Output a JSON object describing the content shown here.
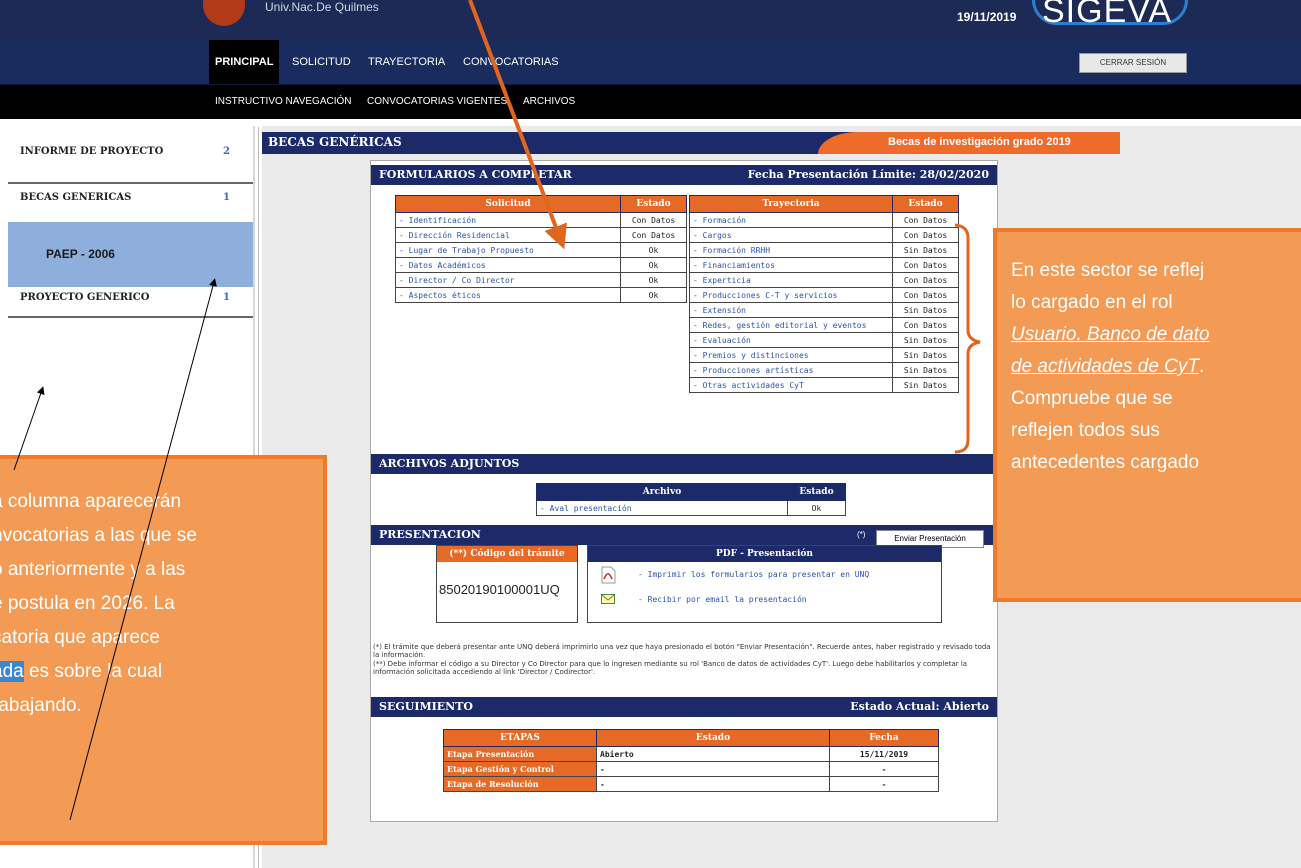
{
  "header": {
    "institution": "Univ.Nac.De Quilmes",
    "date": "19/11/2019",
    "brand": "SIGEVA",
    "logout_label": "CERRAR SESIÓN"
  },
  "nav_main": [
    "PRINCIPAL",
    "SOLICITUD",
    "TRAYECTORIA",
    "CONVOCATORIAS"
  ],
  "nav_sub": [
    "INSTRUCTIVO NAVEGACIÓN",
    "CONVOCATORIAS VIGENTES",
    "ARCHIVOS"
  ],
  "sidebar": {
    "items": [
      {
        "label": "INFORME DE PROYECTO",
        "count": "2"
      },
      {
        "label": "BECAS GENERICAS",
        "count": "1"
      },
      {
        "label": "PAEP - 2006",
        "count": ""
      },
      {
        "label": "PROYECTO GENERICO",
        "count": "1"
      }
    ]
  },
  "page": {
    "title": "BECAS GENÉRICAS",
    "subtitle": "Becas de investigación grado 2019"
  },
  "forms": {
    "title": "FORMULARIOS A COMPLETAR",
    "deadline": "Fecha Presentación Límite: 28/02/2020",
    "solicitud": {
      "headers": [
        "Solicitud",
        "Estado"
      ],
      "rows": [
        [
          "- Identificación",
          "Con Datos"
        ],
        [
          "- Dirección Residencial",
          "Con Datos"
        ],
        [
          "- Lugar de Trabajo Propuesto",
          "Ok"
        ],
        [
          "- Datos Académicos",
          "Ok"
        ],
        [
          "- Director / Co Director",
          "Ok"
        ],
        [
          "- Aspectos éticos",
          "Ok"
        ]
      ]
    },
    "trayectoria": {
      "headers": [
        "Trayectoria",
        "Estado"
      ],
      "rows": [
        [
          "- Formación",
          "Con Datos"
        ],
        [
          "- Cargos",
          "Con Datos"
        ],
        [
          "- Formación RRHH",
          "Sin Datos"
        ],
        [
          "- Financiamientos",
          "Con Datos"
        ],
        [
          "- Experticia",
          "Con Datos"
        ],
        [
          "- Producciones C-T y servicios",
          "Con Datos"
        ],
        [
          "- Extensión",
          "Sin Datos"
        ],
        [
          "- Redes, gestión editorial y eventos",
          "Con Datos"
        ],
        [
          "- Evaluación",
          "Sin Datos"
        ],
        [
          "- Premios y distinciones",
          "Sin Datos"
        ],
        [
          "- Producciones artísticas",
          "Sin Datos"
        ],
        [
          "- Otras actividades CyT",
          "Sin Datos"
        ]
      ]
    }
  },
  "attachments": {
    "title": "ARCHIVOS ADJUNTOS",
    "headers": [
      "Archivo",
      "Estado"
    ],
    "rows": [
      [
        "- Aval presentación",
        "Ok"
      ]
    ]
  },
  "presentation": {
    "title": "PRESENTACION",
    "send_note": "(*)",
    "send_label": "Enviar Presentación",
    "code_header": "(**) Código del trámite",
    "code_value": "85020190100001UQ",
    "pdf_header": "PDF - Presentación",
    "pdf_print": "- Imprimir los formularios para presentar en UNQ",
    "pdf_email": "- Recibir por email la presentación",
    "note_1": "(*) El trámite que deberá presentar ante UNQ deberá imprimirlo una vez que haya presionado el botón \"Enviar Presentación\". Recuerde antes, haber registrado y revisado toda la información.",
    "note_2": "(**) Debe informar el código a su Director y Co Director para que lo ingresen mediante su rol 'Banco de datos de actividades CyT'. Luego debe habilitarlos y completar la información solicitada accediendo al link 'Director / Codirector'."
  },
  "tracking": {
    "title": "SEGUIMIENTO",
    "status": "Estado Actual: Abierto",
    "headers": [
      "ETAPAS",
      "Estado",
      "Fecha"
    ],
    "rows": [
      [
        "Etapa Presentación",
        "Abierto",
        "15/11/2019"
      ],
      [
        "Etapa Gestión y Control",
        "-",
        "-"
      ],
      [
        "Etapa de Resolución",
        "-",
        "-"
      ]
    ]
  },
  "annotations": {
    "right": {
      "line1": "En este sector se reflej",
      "line2": "lo cargado en el rol",
      "line3": "Usuario. Banco de dato",
      "line4": "de actividades de CyT",
      "line4_end": ".",
      "line5": "Compruebe que se",
      "line6": "reflejen todos sus",
      "line7": "antecedentes cargado"
    },
    "left": {
      "line1": "a columna aparecerán",
      "line2": "nvocatorias a las que se",
      "line3": "ó anteriormente y a las",
      "line4": "e postula en 2026.  La",
      "line5": "catoria que aparece",
      "line6a": "ada",
      "line6b": " es sobre la cual",
      "line7": "rabajando."
    }
  },
  "colors": {
    "navy": "#1d2a6a",
    "orange": "#e66a26",
    "note": "#f39a55",
    "selected": "#8eaedb"
  }
}
